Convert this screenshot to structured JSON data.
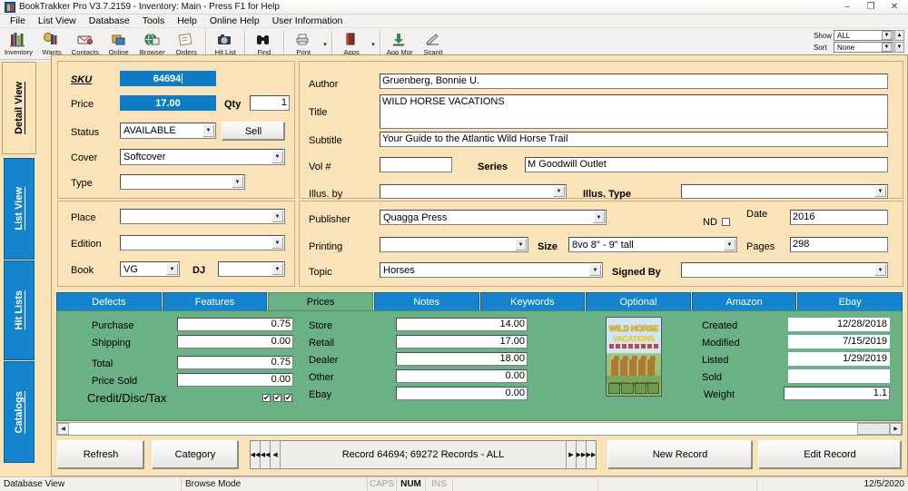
{
  "window": {
    "title": "BookTrakker Pro V3.7.2159 - Inventory: Main - Press F1 for Help",
    "minimize": "–",
    "maximize": "❐",
    "close": "✕"
  },
  "menubar": {
    "items": [
      "File",
      "List View",
      "Database",
      "Tools",
      "Help",
      "Online Help",
      "User Information"
    ]
  },
  "toolbar": {
    "buttons": [
      {
        "label": "Inventory",
        "icon": "books-icon",
        "glyph": "📚"
      },
      {
        "label": "Wants",
        "icon": "wants-icon",
        "glyph": "📓"
      },
      {
        "label": "Contacts",
        "icon": "contacts-icon",
        "glyph": "📇"
      },
      {
        "label": "Online",
        "icon": "online-icon",
        "glyph": "📠"
      },
      {
        "label": "Browser",
        "icon": "browser-globe-icon",
        "glyph": "🌐"
      },
      {
        "label": "Orders",
        "icon": "orders-icon",
        "glyph": "📄"
      },
      {
        "label": "Hit List",
        "icon": "camera-icon",
        "glyph": "📷"
      },
      {
        "label": "Find",
        "icon": "binoculars-icon",
        "glyph": "🔭"
      },
      {
        "label": "Print",
        "icon": "printer-icon",
        "glyph": "🖨"
      },
      {
        "label": "Apps",
        "icon": "apps-book-icon",
        "glyph": "📕"
      },
      {
        "label": "App Mgr",
        "icon": "download-icon",
        "glyph": "⬇"
      },
      {
        "label": "Scanit",
        "icon": "scanner-icon",
        "glyph": "✒"
      }
    ],
    "dropdown_caret": "▾"
  },
  "filters": {
    "show_label": "Show",
    "show_value": "ALL",
    "sort_label": "Sort",
    "sort_value": "None",
    "arrow": "▼",
    "spin_up": "▲",
    "spin_down": "▼"
  },
  "sidebar": {
    "items": [
      {
        "label": "Detail View",
        "active": true
      },
      {
        "label": "List View",
        "active": false
      },
      {
        "label": "Hit Lists",
        "active": false
      },
      {
        "label": "Catalogs",
        "active": false
      }
    ]
  },
  "detail": {
    "sku_label": "SKU",
    "sku_value": "64694",
    "price_label": "Price",
    "price_value": "17.00",
    "qty_label": "Qty",
    "qty_value": "1",
    "status_label": "Status",
    "status_value": "AVAILABLE",
    "sell_label": "Sell",
    "cover_label": "Cover",
    "cover_value": "Softcover",
    "type_label": "Type",
    "type_value": "",
    "place_label": "Place",
    "place_value": "",
    "edition_label": "Edition",
    "edition_value": "",
    "book_label": "Book",
    "book_value": "VG",
    "dj_label": "DJ",
    "dj_value": "",
    "author_label": "Author",
    "author_value": "Gruenberg, Bonnie U.",
    "title_label": "Title",
    "title_value": "WILD HORSE VACATIONS",
    "subtitle_label": "Subtitle",
    "subtitle_value": "Your Guide to the Atlantic Wild Horse Trail",
    "vol_label": "Vol #",
    "vol_value": "",
    "series_label": "Series",
    "series_value": "M Goodwill Outlet",
    "illus_by_label": "Illus. by",
    "illus_by_value": "",
    "illus_type_label": "Illus. Type",
    "illus_type_value": "",
    "publisher_label": "Publisher",
    "publisher_value": "Quagga Press",
    "nd_label": "ND",
    "date_label": "Date",
    "date_value": "2016",
    "printing_label": "Printing",
    "printing_value": "",
    "size_label": "Size",
    "size_value": "8vo  8\" - 9\" tall",
    "pages_label": "Pages",
    "pages_value": "298",
    "topic_label": "Topic",
    "topic_value": "Horses",
    "signed_by_label": "Signed By",
    "signed_by_value": ""
  },
  "tabs": [
    {
      "label": "Defects",
      "active": false
    },
    {
      "label": "Features",
      "active": false
    },
    {
      "label": "Prices",
      "active": true
    },
    {
      "label": "Notes",
      "active": false
    },
    {
      "label": "Keywords",
      "active": false
    },
    {
      "label": "Optional",
      "active": false
    },
    {
      "label": "Amazon",
      "active": false
    },
    {
      "label": "Ebay",
      "active": false
    }
  ],
  "prices": {
    "left": [
      {
        "label": "Purchase",
        "value": "0.75"
      },
      {
        "label": "Shipping",
        "value": "0.00"
      },
      {
        "label": "Total",
        "value": "0.75"
      },
      {
        "label": "Price Sold",
        "value": "0.00"
      }
    ],
    "credit_label": "Credit/Disc/Tax",
    "credit_checked": [
      true,
      true,
      true
    ],
    "middle": [
      {
        "label": "Store",
        "value": "14.00"
      },
      {
        "label": "Retail",
        "value": "17.00"
      },
      {
        "label": "Dealer",
        "value": "18.00"
      },
      {
        "label": "Other",
        "value": "0.00"
      },
      {
        "label": "Ebay",
        "value": "0.00"
      }
    ],
    "right": [
      {
        "label": "Created",
        "value": "12/28/2018"
      },
      {
        "label": "Modified",
        "value": "7/15/2019"
      },
      {
        "label": "Listed",
        "value": "1/29/2019"
      },
      {
        "label": "Sold",
        "value": ""
      },
      {
        "label": "Weight",
        "value": "1.1"
      }
    ]
  },
  "cover_image": {
    "alt": "book-cover-thumbnail",
    "title_line1": "WILD HORSE",
    "title_line2": "VACATIONS",
    "author": "BONNIE U. GRUENBERG"
  },
  "footer": {
    "refresh_label": "Refresh",
    "category_label": "Category",
    "record_status": "Record 64694;  69272 Records - ALL",
    "new_record_label": "New Record",
    "edit_record_label": "Edit Record",
    "nav_first": "◀◀",
    "nav_prev_page": "◀◀",
    "nav_prev": "◀",
    "nav_next": "▶",
    "nav_next_page": "▶▶",
    "nav_last": "▶▶",
    "scroll_left": "◀",
    "scroll_right": "▶"
  },
  "statusbar": {
    "view_mode": "Database View",
    "browse_mode": "Browse Mode",
    "caps": "CAPS",
    "num": "NUM",
    "ins": "INS",
    "date": "12/5/2020"
  },
  "colors": {
    "tan": "#fae3b9",
    "blue_tab": "#1384cd",
    "green_panel": "#6ab185",
    "blue_field": "#0d7cc4"
  }
}
